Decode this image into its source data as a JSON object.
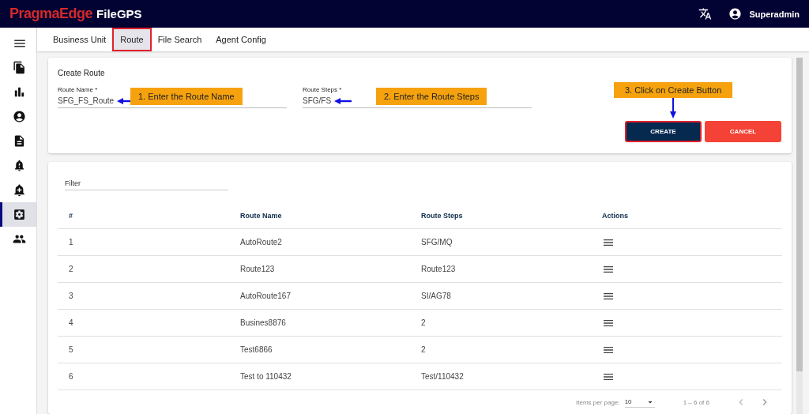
{
  "header": {
    "brand": "PragmaEdge",
    "product": "FileGPS",
    "user": "Superadmin"
  },
  "sidebar": {
    "items": [
      {
        "selected": false
      },
      {
        "selected": false
      },
      {
        "selected": false
      },
      {
        "selected": false
      },
      {
        "selected": false
      },
      {
        "selected": false
      },
      {
        "selected": true
      },
      {
        "selected": false
      }
    ]
  },
  "tabs": [
    {
      "label": "Business Unit",
      "selected": false
    },
    {
      "label": "Route",
      "selected": true
    },
    {
      "label": "File Search",
      "selected": false
    },
    {
      "label": "Agent Config",
      "selected": false
    }
  ],
  "create_route": {
    "title": "Create Route",
    "fields": [
      {
        "label": "Route Name *",
        "value": "SFG_FS_Route",
        "callout": "1. Enter the Route Name"
      },
      {
        "label": "Route Steps *",
        "value": "SFG/FS",
        "callout": "2. Enter the Route Steps"
      }
    ],
    "buttons": [
      {
        "label": "CREATE",
        "kind": "primary",
        "highlighted": true,
        "callout": "3. Click on Create Button"
      },
      {
        "label": "CANCEL",
        "kind": "danger",
        "highlighted": false
      }
    ]
  },
  "filter": {
    "placeholder": "Filter"
  },
  "table": {
    "columns": [
      "#",
      "Route Name",
      "Route Steps",
      "Actions"
    ],
    "rows": [
      [
        "1",
        "AutoRoute2",
        "SFG/MQ"
      ],
      [
        "2",
        "Route123",
        "Route123"
      ],
      [
        "3",
        "AutoRoute167",
        "SI/AG78"
      ],
      [
        "4",
        "Busines8876",
        "2"
      ],
      [
        "5",
        "Test6866",
        "2"
      ],
      [
        "6",
        "Test to 110432",
        "Test/110432"
      ]
    ]
  },
  "paginator": {
    "label": "Items per page:",
    "page_size": "10",
    "range": "1 – 6 of 6"
  }
}
